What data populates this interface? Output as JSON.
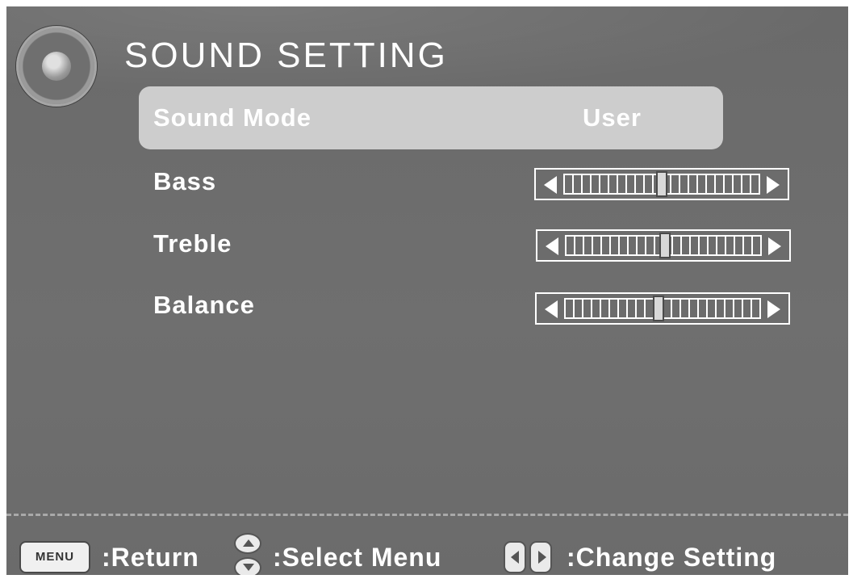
{
  "header": {
    "title": "SOUND SETTING",
    "icon": "speaker-icon"
  },
  "menu": {
    "selected_index": 0,
    "items": [
      {
        "label": "Sound Mode",
        "value": "User",
        "type": "option"
      },
      {
        "label": "Bass",
        "type": "slider",
        "level_fraction": 0.5
      },
      {
        "label": "Treble",
        "type": "slider",
        "level_fraction": 0.51
      },
      {
        "label": "Balance",
        "type": "slider",
        "level_fraction": 0.48
      }
    ]
  },
  "footer": {
    "menu_key": "MENU",
    "return_hint": ":Return",
    "select_hint": ":Select Menu",
    "change_hint": ":Change Setting"
  },
  "colors": {
    "background": "#6a6a6a",
    "highlight": "#cdcdcd",
    "text": "#ffffff"
  }
}
